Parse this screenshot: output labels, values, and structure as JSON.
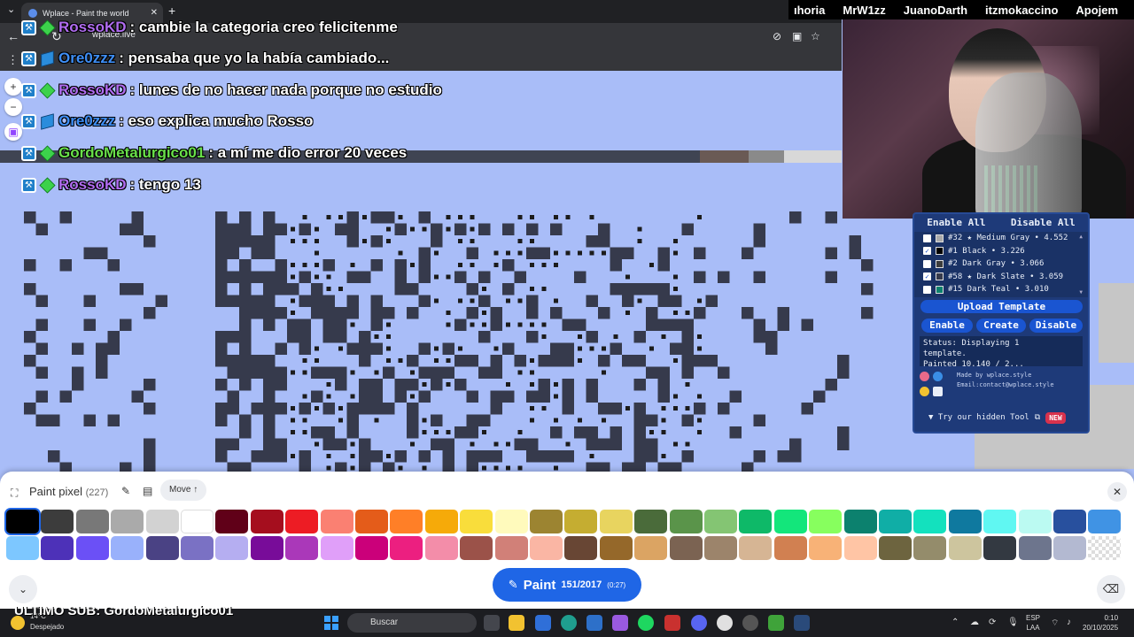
{
  "browser": {
    "tab_title": "Wplace - Paint the world",
    "url": "wplace.live"
  },
  "stream_names": [
    "ıhoria",
    "MrW1zz",
    "JuanoDarth",
    "itzmokaccino",
    "Apojem"
  ],
  "chat": [
    {
      "user": "RossoKD",
      "color": "#b06cf0",
      "badges": [
        "hammer",
        "gem"
      ],
      "text": ": cambie la categoria creo felicitenme"
    },
    {
      "user": "Ore0zzz",
      "color": "#3e8ef5",
      "badges": [
        "hammer",
        "cube"
      ],
      "text": ": pensaba que yo la había cambiado..."
    },
    {
      "user": "RossoKD",
      "color": "#b06cf0",
      "badges": [
        "hammer",
        "gem"
      ],
      "text": ": lunes de no hacer nada porque no estudio"
    },
    {
      "user": "Ore0zzz",
      "color": "#3e8ef5",
      "badges": [
        "hammer",
        "cube"
      ],
      "text": ": eso explica mucho Rosso"
    },
    {
      "user": "GordoMetalurgico01",
      "color": "#69e04a",
      "badges": [
        "hammer",
        "gem"
      ],
      "text": ": a mí me dio error 20 veces"
    },
    {
      "user": "RossoKD",
      "color": "#b06cf0",
      "badges": [
        "hammer",
        "gem"
      ],
      "text": ": tengo 13"
    }
  ],
  "template_panel": {
    "enable_all": "Enable All",
    "disable_all": "Disable All",
    "colors": [
      {
        "checked": false,
        "swatch": "#aaaaaa",
        "label": "#32 ★ Medium Gray • 4.552"
      },
      {
        "checked": true,
        "swatch": "#000000",
        "label": "#1 Black • 3.226"
      },
      {
        "checked": false,
        "swatch": "#3c3c3c",
        "label": "#2 Dark Gray • 3.066"
      },
      {
        "checked": true,
        "swatch": "#363a4c",
        "label": "#58 ★ Dark Slate • 3.059"
      },
      {
        "checked": false,
        "swatch": "#0c816e",
        "label": "#15 Dark Teal • 3.010"
      }
    ],
    "upload": "Upload Template",
    "enable": "Enable",
    "create": "Create",
    "disable": "Disable",
    "status_line1": "Status: Displaying 1",
    "status_line2": "template.",
    "status_line3": "Painted 10.140 / 2...",
    "made_by": "Made by wplace.style",
    "email": "Email:contact@wplace.style",
    "hidden_tool": "▼ Try our hidden Tool",
    "new_badge": "NEW"
  },
  "toolbar": {
    "title": "Paint pixel",
    "count": "(227)",
    "move_label": "Move ↑",
    "paint_label": "Paint",
    "charges": "151/2017",
    "timer": "(0:27)"
  },
  "palette": {
    "row1": [
      "#000000",
      "#3c3c3c",
      "#787878",
      "#aaaaaa",
      "#d2d2d2",
      "#ffffff",
      "#600018",
      "#a50e1e",
      "#ed1c24",
      "#fa8072",
      "#e45c1a",
      "#ff7f27",
      "#f6aa09",
      "#f9dd3b",
      "#fffabc",
      "#9c8431",
      "#c5ad31",
      "#e8d45f",
      "#4a6b3a",
      "#5a944a",
      "#84c573",
      "#0eb968",
      "#13e67b",
      "#87ff5e",
      "#0c816e",
      "#10aea6",
      "#13e1be",
      "#0f799f",
      "#60f7f2",
      "#bbfaf2",
      "#28509e",
      "#4093e4"
    ],
    "row2": [
      "#7dc7ff",
      "#4d31b8",
      "#6b50f6",
      "#99b1fb",
      "#4a4284",
      "#7a71c4",
      "#b5aef1",
      "#780c99",
      "#aa38b9",
      "#e09ff9",
      "#cb007a",
      "#ec1f80",
      "#f38da9",
      "#9b5249",
      "#d18078",
      "#fab6a4",
      "#684634",
      "#95682a",
      "#dba463",
      "#7b6352",
      "#9c846b",
      "#d6b594",
      "#d18051",
      "#f8b277",
      "#ffc5a5",
      "#6d643f",
      "#948c6b",
      "#cdc59e",
      "#333941",
      "#6d758d",
      "#b3b9d1",
      "transparent"
    ]
  },
  "taskbar": {
    "last_sub": "ULTIMO SUB: GordoMetalurgico01",
    "weather_temp": "14°C",
    "weather_desc": "Despejado",
    "search_placeholder": "Buscar",
    "lang1": "ESP",
    "lang2": "LAA",
    "time": "0:10",
    "date": "20/10/2025"
  }
}
